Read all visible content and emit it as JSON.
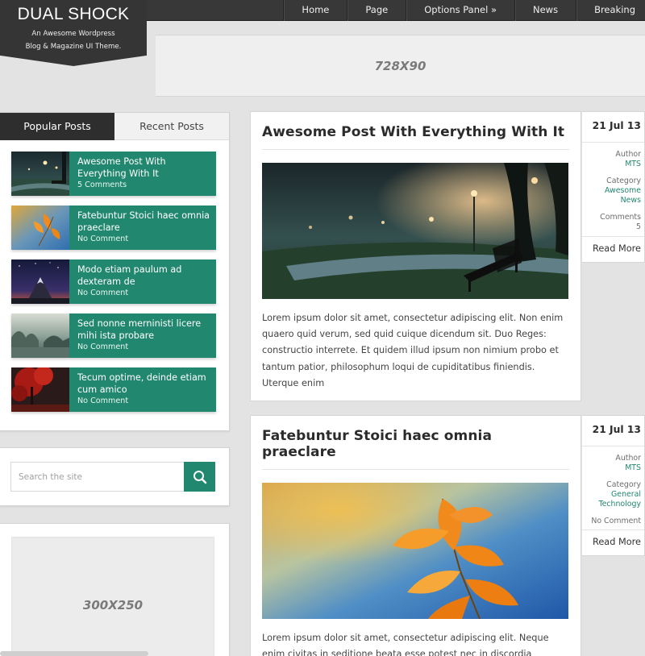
{
  "nav": {
    "items": [
      "Home",
      "Page",
      "Options Panel »",
      "News",
      "Breaking"
    ]
  },
  "logo": {
    "title": "DUAL SHOCK",
    "tagline_1": "An Awesome Wordpress",
    "tagline_2": "Blog & Magazine UI Theme."
  },
  "ad_banner": {
    "label": "728X90"
  },
  "sidebar": {
    "tabs": [
      "Popular Posts",
      "Recent Posts"
    ],
    "posts": [
      {
        "title": "Awesome Post With Everything With It",
        "meta": "5 Comments"
      },
      {
        "title": "Fatebuntur Stoici haec omnia praeclare",
        "meta": "No Comment"
      },
      {
        "title": "Modo etiam paulum ad dexteram de",
        "meta": "No Comment"
      },
      {
        "title": "Sed nonne merninisti licere mihi ista probare",
        "meta": "No Comment"
      },
      {
        "title": "Tecum optime, deinde etiam cum amico",
        "meta": "No Comment"
      }
    ],
    "search": {
      "placeholder": "Search the site"
    },
    "ad_box": {
      "label": "300X250"
    }
  },
  "articles": [
    {
      "title": "Awesome Post With Everything With It",
      "excerpt": "Lorem ipsum dolor sit amet, consectetur adipiscing elit. Non enim quaero quid verum, sed quid cuique dicendum sit. Duo Reges: constructio interrete. Et quidem illud ipsum non nimium probo et tantum patior, philosophum loqui de cupiditatibus finiendis. Uterque enim",
      "meta": {
        "date": "21 Jul 13",
        "author_label": "Author",
        "author": "MTS",
        "category_label": "Category",
        "categories": [
          "Awesome",
          "News"
        ],
        "comments_label": "Comments",
        "comments": "5",
        "read_more": "Read More"
      }
    },
    {
      "title": "Fatebuntur Stoici haec omnia praeclare",
      "excerpt": "Lorem ipsum dolor sit amet, consectetur adipiscing elit. Neque enim civitas in seditione beata esse potest nec in discordia dominorum domus; Immo videri fortasse. Si enim ita est, vide ne",
      "meta": {
        "date": "21 Jul 13",
        "author_label": "Author",
        "author": "MTS",
        "category_label": "Category",
        "categories": [
          "General",
          "Technology"
        ],
        "comments": "No Comment",
        "read_more": "Read More"
      }
    }
  ],
  "colors": {
    "accent": "#22876f",
    "nav_bg": "#383838",
    "page_bg": "#e3e3e3"
  },
  "icons": {
    "search": "search-icon"
  }
}
